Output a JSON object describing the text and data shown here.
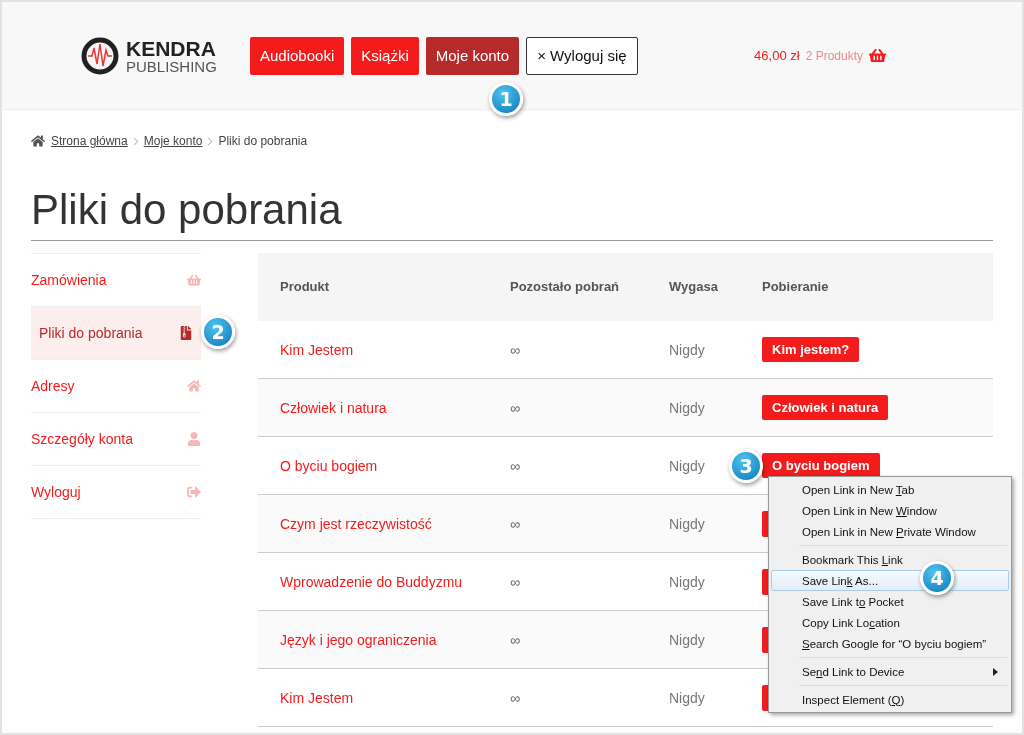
{
  "header": {
    "logo": {
      "title": "KENDRA",
      "subtitle": "PUBLISHING"
    },
    "nav": [
      {
        "label": "Audiobooki",
        "kind": "link",
        "selected": false
      },
      {
        "label": "Książki",
        "kind": "link",
        "selected": false
      },
      {
        "label": "Moje konto",
        "kind": "link",
        "selected": true
      },
      {
        "label": "× Wyloguj się",
        "kind": "outline",
        "selected": false
      }
    ],
    "cart": {
      "total": "46,00 zł",
      "count": "2 Produkty"
    }
  },
  "breadcrumb": [
    "Strona główna",
    "Moje konto",
    "Pliki do pobrania"
  ],
  "page_title": "Pliki do pobrania",
  "sidebar": {
    "items": [
      {
        "label": "Zamówienia",
        "selected": false
      },
      {
        "label": "Pliki do pobrania",
        "selected": true
      },
      {
        "label": "Adresy",
        "selected": false
      },
      {
        "label": "Szczegóły konta",
        "selected": false
      },
      {
        "label": "Wyloguj",
        "selected": false
      }
    ]
  },
  "table": {
    "columns": [
      "Produkt",
      "Pozostało pobrań",
      "Wygasa",
      "Pobieranie"
    ],
    "rows": [
      {
        "product": "Kim Jestem",
        "remaining": "∞",
        "expires": "Nigdy",
        "download": "Kim jestem?"
      },
      {
        "product": "Człowiek i natura",
        "remaining": "∞",
        "expires": "Nigdy",
        "download": "Człowiek i natura"
      },
      {
        "product": "O byciu bogiem",
        "remaining": "∞",
        "expires": "Nigdy",
        "download": "O byciu bogiem"
      },
      {
        "product": "Czym jest rzeczywistość",
        "remaining": "∞",
        "expires": "Nigdy"
      },
      {
        "product": "Wprowadzenie do Buddyzmu",
        "remaining": "∞",
        "expires": "Nigdy"
      },
      {
        "product": "Język i jego ograniczenia",
        "remaining": "∞",
        "expires": "Nigdy"
      },
      {
        "product": "Kim Jestem",
        "remaining": "∞",
        "expires": "Nigdy"
      }
    ]
  },
  "context_menu": {
    "groups": [
      [
        {
          "before": "Open Link in New ",
          "key": "T",
          "after": "ab",
          "selected": false,
          "submenu": false
        },
        {
          "before": "Open Link in New ",
          "key": "W",
          "after": "indow",
          "selected": false,
          "submenu": false
        },
        {
          "before": "Open Link in New ",
          "key": "P",
          "after": "rivate Window",
          "selected": false,
          "submenu": false
        }
      ],
      [
        {
          "before": "Bookmark This ",
          "key": "L",
          "after": "ink",
          "selected": false,
          "submenu": false
        },
        {
          "before": "Save Lin",
          "key": "k",
          "after": " As...",
          "selected": true,
          "submenu": false
        },
        {
          "before": "Save Link t",
          "key": "o",
          "after": " Pocket",
          "selected": false,
          "submenu": false
        },
        {
          "before": "Copy Link Lo",
          "key": "c",
          "after": "ation",
          "selected": false,
          "submenu": false
        },
        {
          "key": "S",
          "after": "earch Google for “O byciu bogiem”",
          "selected": false,
          "submenu": false
        }
      ],
      [
        {
          "before": "Se",
          "key": "n",
          "after": "d Link to Device",
          "selected": false,
          "submenu": true
        }
      ],
      [
        {
          "before": "Inspect Element (",
          "key": "Q",
          "after": ")",
          "selected": false,
          "submenu": false
        }
      ]
    ]
  },
  "callouts": [
    "1",
    "2",
    "3",
    "4"
  ]
}
